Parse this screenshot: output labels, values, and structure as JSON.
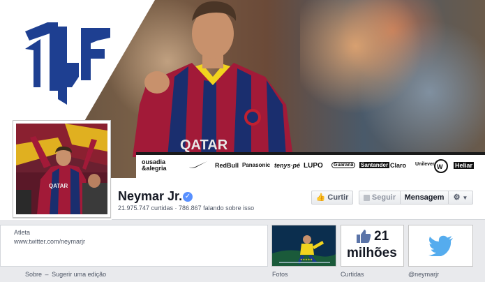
{
  "cover": {
    "sponsors": [
      "ousadia &alegria",
      "RedBull",
      "Panasonic",
      "tenys·pé",
      "LUPO",
      "Guaraná",
      "Santander",
      "Claro",
      "Unilever",
      "VW",
      "Heliar"
    ]
  },
  "profile": {
    "name": "Neymar Jr.",
    "stats": "21.975.747 curtidas · 786.867 falando sobre isso",
    "verified_icon": "verified-check-icon"
  },
  "actions": {
    "like_label": "Curtir",
    "follow_label": "Seguir",
    "message_label": "Mensagem"
  },
  "about": {
    "category": "Atleta",
    "link": "www.twitter.com/neymarjr",
    "about_link": "Sobre",
    "separator": "–",
    "suggest_link": "Sugerir uma edição"
  },
  "tiles": {
    "photos_label": "Fotos",
    "likes_count": "21",
    "likes_unit": "milhões",
    "likes_label": "Curtidas",
    "twitter_label": "@neymarjr"
  },
  "colors": {
    "fb_blue": "#3b5998",
    "logo_blue": "#1e3f91",
    "twitter_blue": "#55acee",
    "background": "#e9eaed"
  }
}
